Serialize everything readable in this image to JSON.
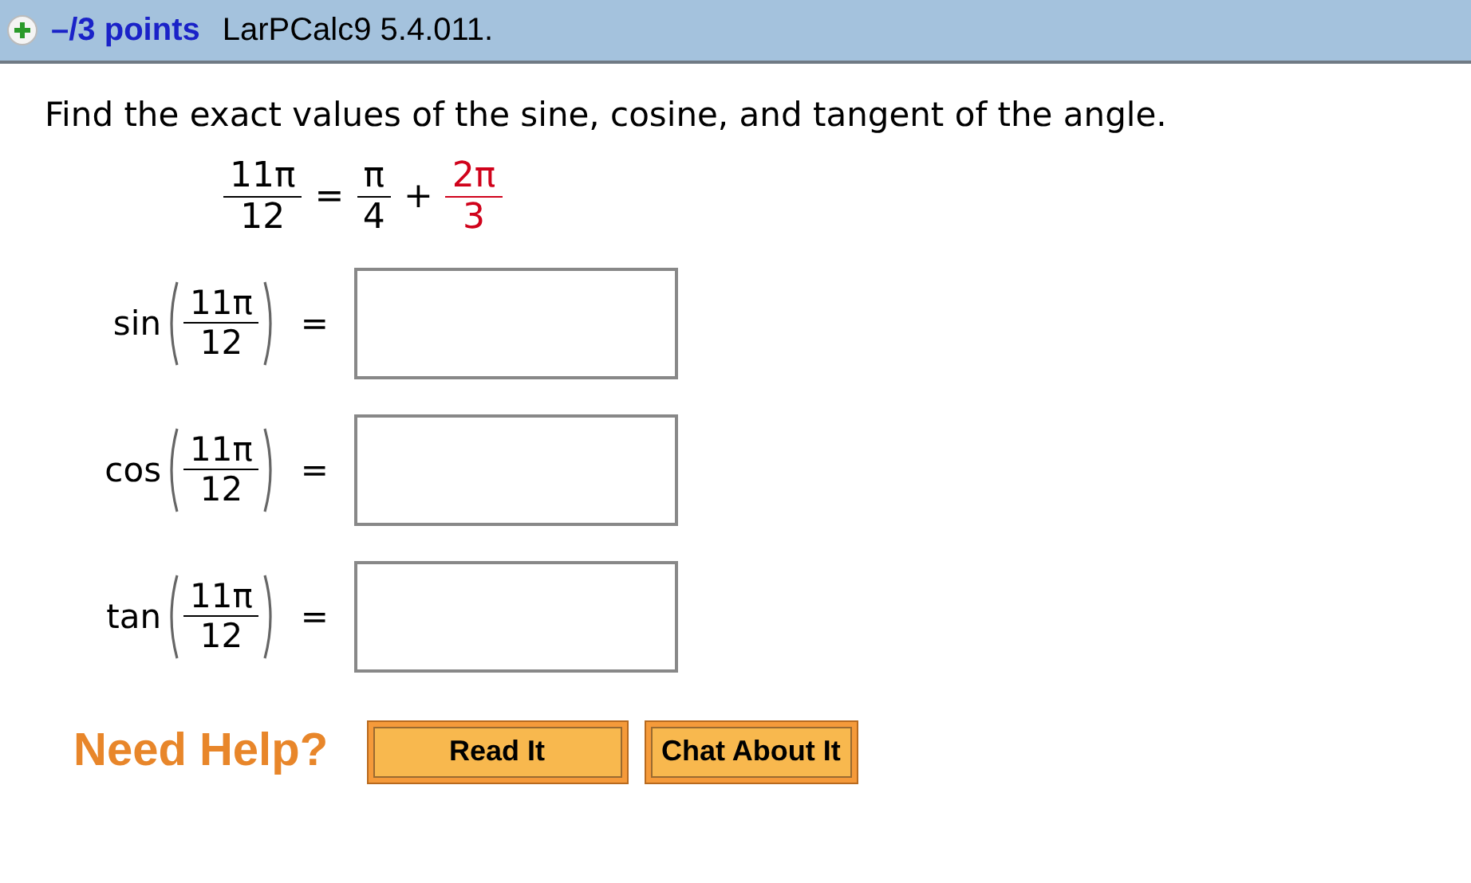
{
  "header": {
    "points": "–/3 points",
    "problem_id": "LarPCalc9 5.4.011."
  },
  "question": "Find the exact values of the sine, cosine, and tangent of the angle.",
  "identity": [
    {
      "kind": "fraction",
      "num": "11π",
      "den": "12",
      "color": "#000000"
    },
    {
      "kind": "operator",
      "text": "="
    },
    {
      "kind": "fraction",
      "num": "π",
      "den": "4",
      "color": "#000000"
    },
    {
      "kind": "operator",
      "text": "+"
    },
    {
      "kind": "fraction",
      "num": "2π",
      "den": "3",
      "color": "#d0021b"
    }
  ],
  "answers": [
    {
      "function": "sin",
      "num": "11π",
      "den": "12",
      "equals": "="
    },
    {
      "function": "cos",
      "num": "11π",
      "den": "12",
      "equals": "="
    },
    {
      "function": "tan",
      "num": "11π",
      "den": "12",
      "equals": "="
    }
  ],
  "help": {
    "label": "Need Help?",
    "buttons": [
      "Read It",
      "Chat About It"
    ]
  }
}
